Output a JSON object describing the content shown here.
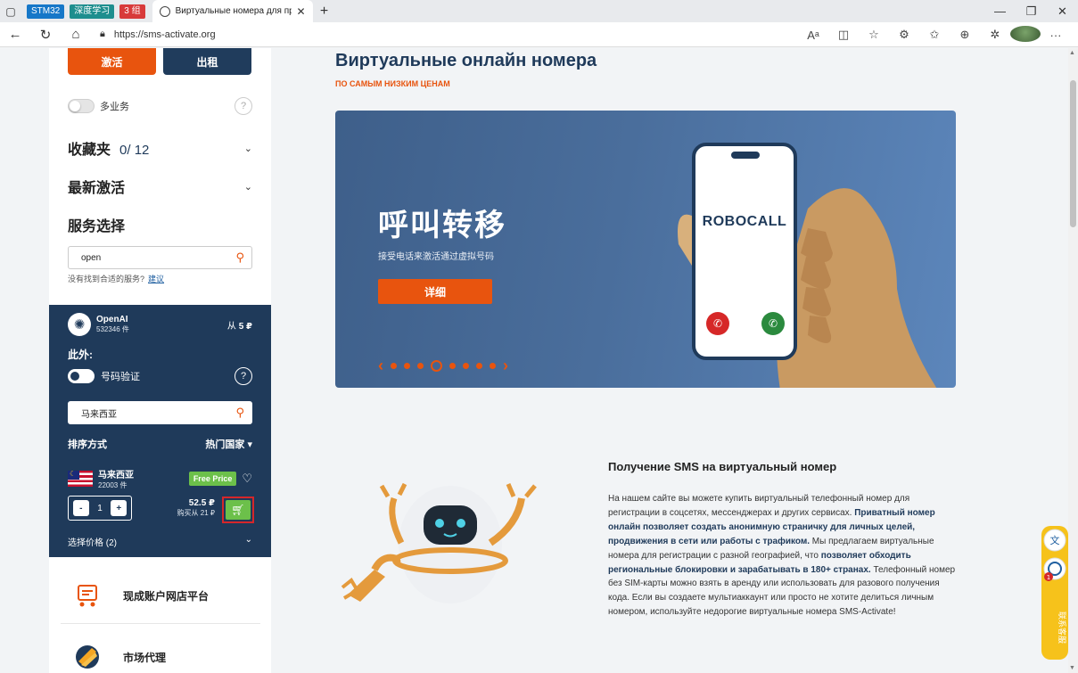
{
  "browser": {
    "bookmarks": [
      {
        "label": "STM32",
        "color": "#1677c8"
      },
      {
        "label": "深度学习",
        "color": "#1e8e8e"
      },
      {
        "label": "3 组",
        "color": "#d83a3a"
      }
    ],
    "tab_title": "Виртуальные номера для прие",
    "url": "https://sms-activate.org"
  },
  "sidebar": {
    "activate_label": "激活",
    "rent_label": "出租",
    "multi_service_label": "多业务",
    "help_glyph": "?",
    "favorites_label": "收藏夹",
    "favorites_count": "0",
    "favorites_total": "/ 12",
    "recent_label": "最新激活",
    "service_select_label": "服务选择",
    "search_value": "open",
    "not_found_text": "没有找到合适的服务?",
    "suggest_link": "建议",
    "service": {
      "name": "OpenAI",
      "count": "532346 件",
      "price_prefix": "从",
      "price": "5 ₽"
    },
    "also_label": "此外:",
    "number_verify_label": "号码验证",
    "country_search_value": "马来西亚",
    "sort_label": "排序方式",
    "sort_value": "热门国家",
    "country": {
      "name": "马来西亚",
      "count": "22003 件",
      "free_price_label": "Free Price",
      "qty": "1",
      "price": "52.5 ₽",
      "buy_from": "购买从 21 ₽"
    },
    "choose_price_label": "选择价格 (2)",
    "promos": [
      {
        "label": "现成账户网店平台",
        "icon": "shop-cart-icon"
      },
      {
        "label": "市场代理",
        "icon": "market-proxy-icon"
      }
    ]
  },
  "main": {
    "heading": "Виртуальные онлайн номера",
    "subheading": "ПО САМЫМ НИЗКИМ ЦЕНАМ",
    "banner": {
      "title": "呼叫转移",
      "subtitle": "接受电话来激活通过虚拟号码",
      "button_label": "详细",
      "phone_text": "ROBOCALL",
      "slide_count": 8,
      "active_slide": 4
    },
    "section_title": "Получение SMS на виртуальный номер",
    "paragraph": [
      {
        "t": "На нашем сайте вы можете купить виртуальный телефонный номер для регистрации в соцсетях, мессенджерах и других сервисах. ",
        "b": false
      },
      {
        "t": "Приватный номер онлайн позволяет создать анонимную страничку для личных целей, продвижения в сети или работы с трафиком.",
        "b": true
      },
      {
        "t": " Мы предлагаем виртуальные номера для регистрации с разной географией, что ",
        "b": false
      },
      {
        "t": "позволяет обходить региональные блокировки и зарабатывать в 180+ странах.",
        "b": true
      },
      {
        "t": " Телефонный номер без SIM-карты можно взять в аренду или использовать для разового получения кода. Если вы создаете мультиаккаунт или просто не хотите делиться личным номером, используйте недорогие виртуальные номера SMS-Activate!",
        "b": false
      }
    ]
  },
  "colors": {
    "accent": "#e8540e",
    "navy": "#1f3a5a",
    "green": "#6cc04a",
    "highlight": "#d6262a"
  },
  "widget": {
    "badge": "1",
    "translate_glyph": "文",
    "vertical_text": "联系客服"
  }
}
